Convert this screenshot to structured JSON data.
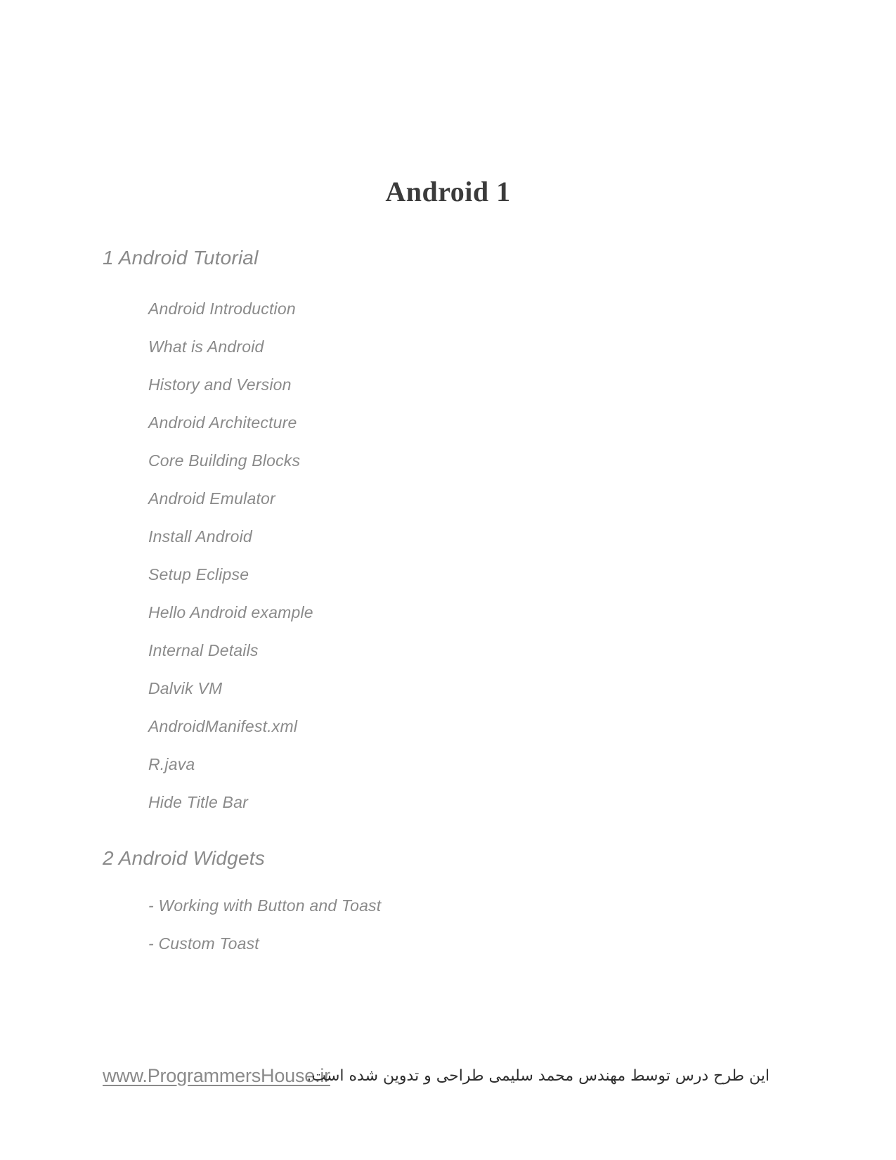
{
  "document": {
    "title": "Android 1"
  },
  "outline": {
    "sections": [
      {
        "heading": "1 Android Tutorial",
        "items": [
          "Android Introduction",
          "What is Android",
          "History and Version",
          "Android Architecture",
          "Core Building Blocks",
          "Android Emulator",
          "Install Android",
          "Setup Eclipse",
          "Hello Android example",
          "Internal Details",
          "Dalvik VM",
          "AndroidManifest.xml",
          "R.java",
          "Hide Title Bar"
        ]
      },
      {
        "heading": "2 Android Widgets",
        "items": [
          "- Working with Button and Toast",
          "- Custom Toast"
        ]
      }
    ]
  },
  "footer": {
    "link_text": "www.ProgrammersHouse.ir",
    "note_text": "این طرح درس توسط مهندس محمد سلیمی طراحی و تدوین شده است."
  },
  "colors": {
    "title": "#3b3b3b",
    "body_text": "#8a8a8a",
    "footer_note": "#2e2e2e",
    "page_background": "#ffffff"
  }
}
